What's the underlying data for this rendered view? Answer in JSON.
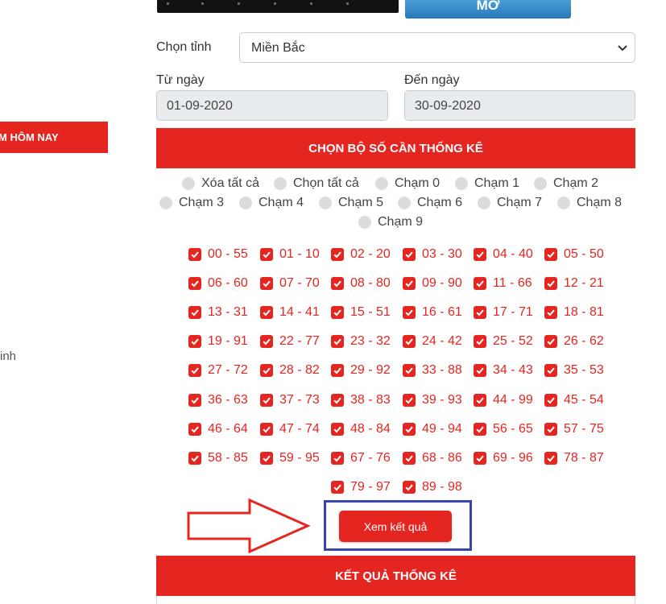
{
  "sidebar": {
    "button_label": "M HÔM NAY",
    "fragment_text": "inh"
  },
  "banner": {
    "button_label": "MỞ"
  },
  "form": {
    "province_label": "Chọn tỉnh",
    "province_value": "Miền Bắc",
    "from_label": "Từ ngày",
    "from_value": "01-09-2020",
    "to_label": "Đến ngày",
    "to_value": "30-09-2020"
  },
  "select_section": {
    "title": "CHỌN BỘ SỐ CẦN THỐNG KÊ"
  },
  "radios": [
    "Xóa tất cả",
    "Chọn tất cả",
    "Chạm 0",
    "Chạm 1",
    "Chạm 2",
    "Chạm 3",
    "Chạm 4",
    "Chạm 5",
    "Chạm 6",
    "Chạm 7",
    "Chạm 8",
    "Chạm 9"
  ],
  "pairs": [
    "00 - 55",
    "01 - 10",
    "02 - 20",
    "03 - 30",
    "04 - 40",
    "05 - 50",
    "06 - 60",
    "07 - 70",
    "08 - 80",
    "09 - 90",
    "11 - 66",
    "12 - 21",
    "13 - 31",
    "14 - 41",
    "15 - 51",
    "16 - 61",
    "17 - 71",
    "18 - 81",
    "19 - 91",
    "22 - 77",
    "23 - 32",
    "24 - 42",
    "25 - 52",
    "26 - 62",
    "27 - 72",
    "28 - 82",
    "29 - 92",
    "33 - 88",
    "34 - 43",
    "35 - 53",
    "36 - 63",
    "37 - 73",
    "38 - 83",
    "39 - 93",
    "44 - 99",
    "45 - 54",
    "46 - 64",
    "47 - 74",
    "48 - 84",
    "49 - 94",
    "56 - 65",
    "57 - 75",
    "58 - 85",
    "59 - 95",
    "67 - 76",
    "68 - 86",
    "69 - 96",
    "78 - 87",
    "79 - 97",
    "89 - 98"
  ],
  "submit_label": "Xem kết quả",
  "results": {
    "title": "KẾT QUẢ THỐNG KÊ"
  },
  "colors": {
    "accent": "#e52520",
    "highlight": "#3a44b0",
    "banner_button": "#2678b8"
  }
}
